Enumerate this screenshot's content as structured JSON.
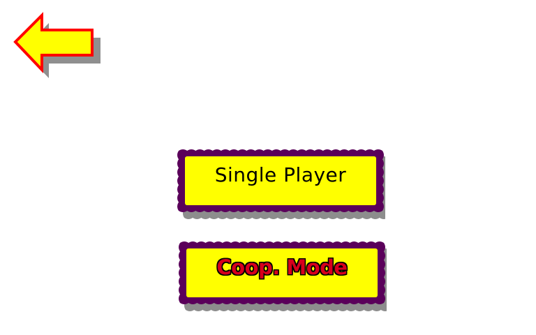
{
  "navigation": {
    "back_icon": "left-arrow-icon"
  },
  "menu": {
    "single_player_label": "Single Player",
    "coop_mode_label": "Coop. Mode"
  },
  "colors": {
    "background": "#ffffff",
    "button_fill": "#ffff00",
    "button_border": "#5a005a",
    "arrow_fill": "#ffff00",
    "arrow_outline": "#ff0000",
    "coop_text": "#d8001c"
  }
}
